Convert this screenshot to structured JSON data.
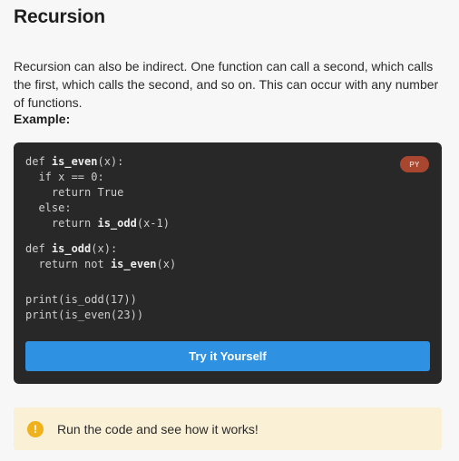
{
  "lesson": {
    "title": "Recursion",
    "paragraph": "Recursion can also be indirect. One function can call a second, which calls the first, which calls the second, and so on. This can occur with any number of functions.",
    "example_label": "Example:"
  },
  "code_block": {
    "language_badge": "PY",
    "lines": [
      {
        "indent": "",
        "parts": [
          {
            "t": "def "
          },
          {
            "t": "is_even",
            "b": true
          },
          {
            "t": "(x):"
          }
        ]
      },
      {
        "indent": "  ",
        "parts": [
          {
            "t": "if x == 0:"
          }
        ]
      },
      {
        "indent": "    ",
        "parts": [
          {
            "t": "return True"
          }
        ]
      },
      {
        "indent": "  ",
        "parts": [
          {
            "t": "else:"
          }
        ]
      },
      {
        "indent": "    ",
        "parts": [
          {
            "t": "return "
          },
          {
            "t": "is_odd",
            "b": true
          },
          {
            "t": "(x-1)"
          }
        ]
      },
      {
        "indent": "",
        "parts": [
          {
            "t": "def "
          },
          {
            "t": "is_odd",
            "b": true
          },
          {
            "t": "(x):"
          }
        ]
      },
      {
        "indent": "  ",
        "parts": [
          {
            "t": "return not "
          },
          {
            "t": "is_even",
            "b": true
          },
          {
            "t": "(x)"
          }
        ]
      },
      {
        "indent": "",
        "parts": [
          {
            "t": "print(is_odd(17))"
          }
        ]
      },
      {
        "indent": "",
        "parts": [
          {
            "t": "print(is_even(23))"
          }
        ]
      }
    ],
    "try_button_label": "Try it Yourself"
  },
  "note": {
    "icon": "exclamation-icon",
    "text": "Run the code and see how it works!"
  }
}
